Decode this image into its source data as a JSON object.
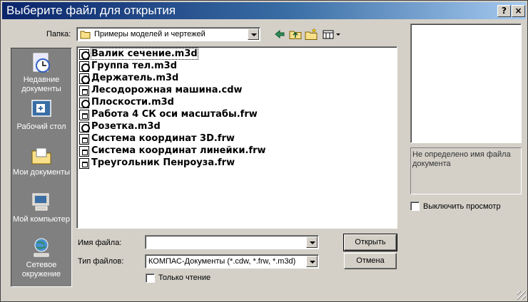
{
  "window": {
    "title": "Выберите файл для открытия",
    "help_label": "?",
    "close_label": "×"
  },
  "lookin": {
    "label": "Папка:",
    "value": "Примеры моделей и чертежей"
  },
  "places": [
    {
      "label": "Недавние документы",
      "icon": "recent-documents-icon"
    },
    {
      "label": "Рабочий стол",
      "icon": "desktop-icon"
    },
    {
      "label": "Мои документы",
      "icon": "my-documents-icon"
    },
    {
      "label": "Мой компьютер",
      "icon": "my-computer-icon"
    },
    {
      "label": "Сетевое окружение",
      "icon": "network-icon"
    }
  ],
  "files": [
    {
      "name": "Валик сечение.m3d",
      "type": "m3d",
      "selected": true
    },
    {
      "name": "Группа тел.m3d",
      "type": "m3d"
    },
    {
      "name": "Держатель.m3d",
      "type": "m3d"
    },
    {
      "name": "Лесодорожная машина.cdw",
      "type": "cdw"
    },
    {
      "name": "Плоскости.m3d",
      "type": "m3d"
    },
    {
      "name": "Работа 4 СК оси масштабы.frw",
      "type": "frw"
    },
    {
      "name": "Розетка.m3d",
      "type": "m3d"
    },
    {
      "name": "Система координат 3D.frw",
      "type": "frw"
    },
    {
      "name": "Система координат линейки.frw",
      "type": "frw"
    },
    {
      "name": "Треугольник Пенроуза.frw",
      "type": "frw"
    }
  ],
  "filename": {
    "label": "Имя файла:",
    "value": ""
  },
  "filetype": {
    "label": "Тип файлов:",
    "value": "КОМПАС-Документы (*.cdw, *.frw, *.m3d)"
  },
  "readonly": {
    "label": "Только чтение"
  },
  "buttons": {
    "open": "Открыть",
    "cancel": "Отмена"
  },
  "preview": {
    "info": "Не определено имя файла документа",
    "disable_label": "Выключить просмотр"
  },
  "colors": {
    "title_start": "#0a246a",
    "title_end": "#a6caf0",
    "face": "#d4d0c8",
    "places_bg": "#808080"
  }
}
